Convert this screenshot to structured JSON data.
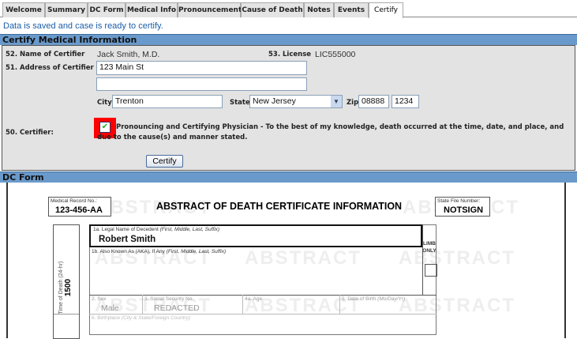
{
  "tabs": [
    "Welcome",
    "Summary",
    "DC Form",
    "Medical Info",
    "Pronouncement",
    "Cause of Death",
    "Notes",
    "Events",
    "Certify"
  ],
  "active_tab": "Certify",
  "message": "Data is saved and case is ready to certify.",
  "certify_section": {
    "title": "Certify Medical Information",
    "name_label": "52. Name of Certifier",
    "name_value": "Jack Smith, M.D.",
    "license_label": "53. License",
    "license_value": "LIC555000",
    "address_label": "51. Address of Certifier",
    "address_line1": "123 Main St",
    "address_line2": "",
    "city_label": "City",
    "city": "Trenton",
    "state_label": "State",
    "state": "New Jersey",
    "zip_label": "Zip",
    "zip": "08888",
    "zip_ext": "1234",
    "certifier_label": "50. Certifier:",
    "certifier_checked": true,
    "certifier_text": "Pronouncing and Certifying Physician - To the best of my knowledge, death occurred at the time, date, and place, and due to the cause(s) and manner stated.",
    "certify_button": "Certify"
  },
  "dc_form": {
    "title": "DC Form",
    "watermark": "ABSTRACT",
    "heading": "ABSTRACT OF DEATH CERTIFICATE INFORMATION",
    "medical_record_label": "Medical Record No.:",
    "medical_record": "123-456-AA",
    "state_file_label": "State File Number:",
    "state_file": "NOTSIGN",
    "time_of_death_label": "Time of Death (24-hr)",
    "time_of_death": "1500",
    "legal_name_label": "1a. Legal Name of Decedent",
    "legal_name_hint": "(First, Middle, Last, Suffix)",
    "legal_name": "Robert Smith",
    "aka_label": "1b. Also Known As (AKA), If Any",
    "aka_hint": "(First, Middle, Last, Suffix)",
    "limb_label": "LIMB ONLY",
    "sex_label": "2. Sex",
    "sex": "Male",
    "ssn_label": "3. Social Security No.",
    "ssn": "REDACTED",
    "age_label": "4a. Age",
    "dob_label": "5. Date of Birth",
    "dob_hint": "(Mo/Day/Yr)",
    "birthplace_label": "6. Birthplace",
    "birthplace_hint": "(City & State/Foreign Country)"
  },
  "colors": {
    "header_bar": "#6a9acb",
    "message": "#1c5ea8",
    "highlight": "#ff0000",
    "panel": "#e3e3e3"
  }
}
